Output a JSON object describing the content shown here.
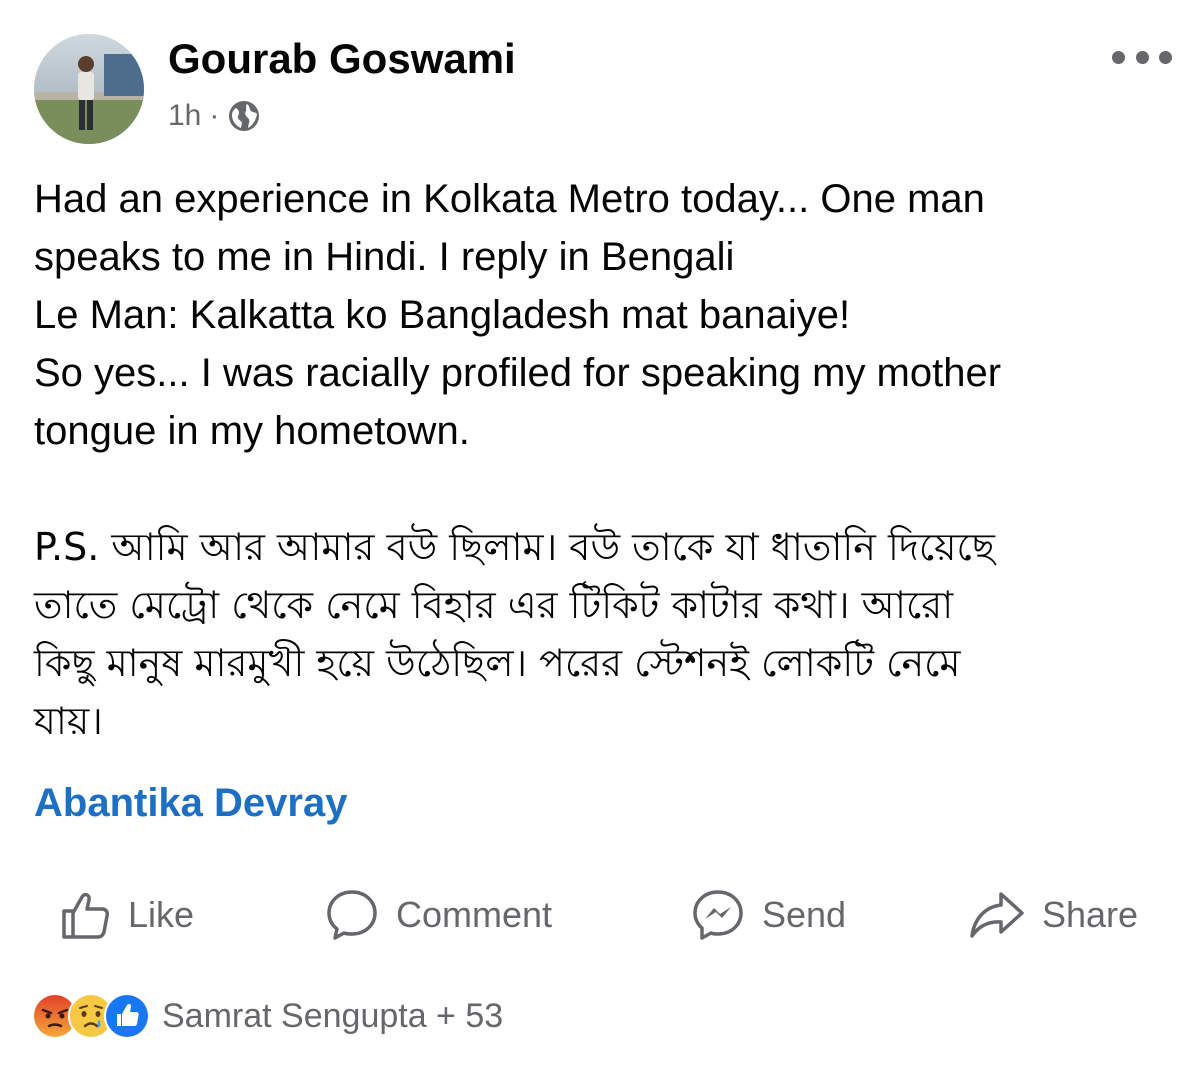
{
  "post": {
    "author": "Gourab Goswami",
    "time": "1h",
    "separator": "·",
    "privacy_icon": "globe-icon",
    "more_icon": "more-options-icon",
    "text_lines": [
      "Had an experience in Kolkata Metro today... One man",
      "speaks to me in Hindi. I reply in Bengali",
      "Le Man: Kalkatta ko Bangladesh mat banaiye!",
      "So yes... I was racially profiled for speaking my mother",
      "tongue in my hometown."
    ],
    "bengali_lines": [
      "P.S. আমি আর আমার বউ ছিলাম। বউ তাকে যা ধাতানি দিয়েছে",
      "তাতে মেট্রো থেকে নেমে বিহার এর টিকিট কাটার কথা। আরো",
      "কিছু মানুষ মারমুখী হয়ে উঠেছিল। পরের স্টেশনই লোকটি নেমে",
      "যায়।"
    ],
    "tagged_person": "Abantika Devray"
  },
  "actions": {
    "like": "Like",
    "comment": "Comment",
    "send": "Send",
    "share": "Share"
  },
  "reactions": {
    "icons": [
      "angry-reaction-icon",
      "sad-reaction-icon",
      "like-reaction-icon"
    ],
    "summary": "Samrat Sengupta + 53"
  },
  "colors": {
    "link_blue": "#1d6fc4",
    "secondary_text": "#65676b",
    "like_blue": "#1877f2",
    "angry_orange": "#e9710f",
    "sad_yellow": "#f7b125"
  }
}
